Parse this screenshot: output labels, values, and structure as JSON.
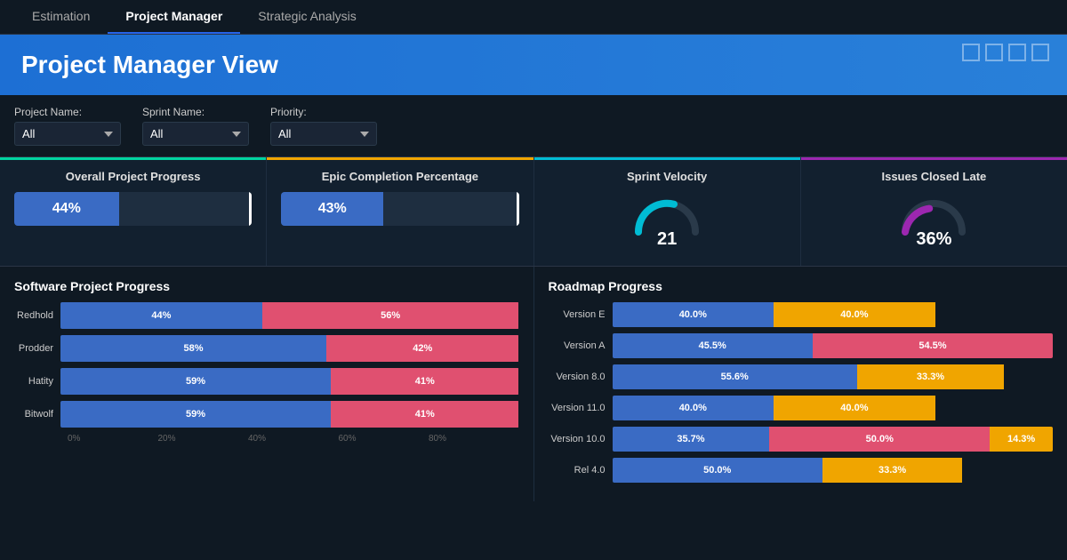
{
  "tabs": [
    {
      "label": "Estimation",
      "active": false
    },
    {
      "label": "Project Manager",
      "active": true
    },
    {
      "label": "Strategic Analysis",
      "active": false
    }
  ],
  "header": {
    "title": "Project Manager View"
  },
  "filters": {
    "project_name": {
      "label": "Project Name:",
      "value": "All",
      "options": [
        "All"
      ]
    },
    "sprint_name": {
      "label": "Sprint Name:",
      "value": "All",
      "options": [
        "All"
      ]
    },
    "priority": {
      "label": "Priority:",
      "value": "All",
      "options": [
        "All"
      ]
    }
  },
  "kpis": [
    {
      "id": "overall-progress",
      "title": "Overall Project Progress",
      "type": "bar",
      "value": "44%",
      "fill": 44,
      "color_class": "green"
    },
    {
      "id": "epic-completion",
      "title": "Epic Completion Percentage",
      "type": "bar",
      "value": "43%",
      "fill": 43,
      "color_class": "yellow"
    },
    {
      "id": "sprint-velocity",
      "title": "Sprint Velocity",
      "type": "gauge",
      "value": "21",
      "color_class": "teal"
    },
    {
      "id": "issues-closed-late",
      "title": "Issues Closed Late",
      "type": "gauge",
      "value": "36%",
      "color_class": "purple"
    }
  ],
  "software_chart": {
    "title": "Software Project Progress",
    "bars": [
      {
        "label": "Redhold",
        "blue": 44,
        "blue_label": "44%",
        "red": 56,
        "red_label": "56%"
      },
      {
        "label": "Prodder",
        "blue": 58,
        "blue_label": "58%",
        "red": 42,
        "red_label": "42%"
      },
      {
        "label": "Hatity",
        "blue": 59,
        "blue_label": "59%",
        "red": 41,
        "red_label": "41%"
      },
      {
        "label": "Bitwolf",
        "blue": 59,
        "blue_label": "59%",
        "red": 41,
        "red_label": "41%"
      }
    ],
    "x_ticks": [
      "0%",
      "20%",
      "40%",
      "60%",
      "80%"
    ]
  },
  "roadmap_chart": {
    "title": "Roadmap Progress",
    "rows": [
      {
        "label": "Version E",
        "segments": [
          {
            "pct": 40,
            "label": "40.0%",
            "color": "blue"
          },
          {
            "pct": 40,
            "label": "40.0%",
            "color": "yellow"
          }
        ]
      },
      {
        "label": "Version A",
        "segments": [
          {
            "pct": 45.5,
            "label": "45.5%",
            "color": "blue"
          },
          {
            "pct": 54.5,
            "label": "54.5%",
            "color": "red"
          }
        ]
      },
      {
        "label": "Version 8.0",
        "segments": [
          {
            "pct": 55.6,
            "label": "55.6%",
            "color": "blue"
          },
          {
            "pct": 33.3,
            "label": "33.3%",
            "color": "yellow"
          }
        ]
      },
      {
        "label": "Version 11.0",
        "segments": [
          {
            "pct": 40,
            "label": "40.0%",
            "color": "blue"
          },
          {
            "pct": 40,
            "label": "40.0%",
            "color": "yellow"
          }
        ]
      },
      {
        "label": "Version 10.0",
        "segments": [
          {
            "pct": 35.7,
            "label": "35.7%",
            "color": "blue"
          },
          {
            "pct": 50,
            "label": "50.0%",
            "color": "red"
          },
          {
            "pct": 14.3,
            "label": "14.3%",
            "color": "yellow"
          }
        ]
      },
      {
        "label": "Rel 4.0",
        "segments": [
          {
            "pct": 50,
            "label": "50.0%",
            "color": "blue"
          },
          {
            "pct": 33.3,
            "label": "33.3%",
            "color": "yellow"
          }
        ]
      }
    ]
  }
}
